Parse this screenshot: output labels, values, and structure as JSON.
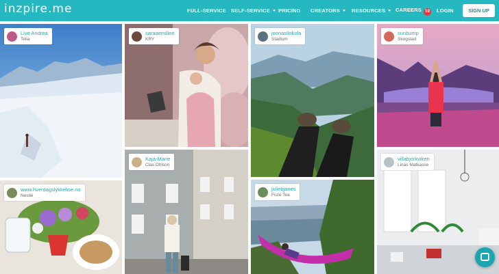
{
  "nav": {
    "logo": "inzpire.me",
    "items": [
      "FULL-SERVICE",
      "SELF-SERVICE",
      "PRICING",
      "CREATORS",
      "RESOURCES",
      "CAREERS"
    ],
    "careers_badge": "10",
    "login": "LOGIN",
    "signup": "SIGN UP",
    "accent_color": "#25b8c0"
  },
  "cards": [
    {
      "user": "Live Andrea",
      "brand": "Telia"
    },
    {
      "user": "saraaemiliee",
      "brand": "KRY"
    },
    {
      "user": "joonaslinkola",
      "brand": "Stadium"
    },
    {
      "user": "sunbump",
      "brand": "Skogstad"
    },
    {
      "user": "www.hverdagslykkelise.no",
      "brand": "Nestlé"
    },
    {
      "user": "Kaja-Marie",
      "brand": "Clas Ohlson"
    },
    {
      "user": "juliebjanes",
      "brand": "Fuze Tea"
    },
    {
      "user": "villabjorkviken",
      "brand": "Linas Matkasse"
    }
  ]
}
